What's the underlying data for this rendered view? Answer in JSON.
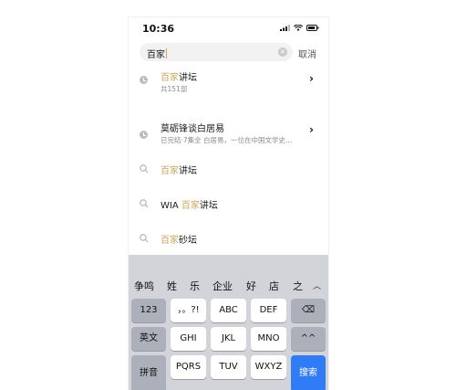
{
  "status_bar": {
    "time": "10:36"
  },
  "search": {
    "query": "百家",
    "cancel_label": "取消",
    "clear_glyph": "×"
  },
  "results": [
    {
      "type": "history",
      "title_hl": "百家",
      "title_rest": "讲坛",
      "subtitle": "共151部",
      "has_chevron": true
    },
    {
      "type": "history",
      "title_hl": "",
      "title_rest": "莫砺锋谈白居易",
      "subtitle": "已完结·7集全 白居易，一位在中国文学史…",
      "has_chevron": true
    },
    {
      "type": "suggest",
      "title_pre": "",
      "title_hl": "百家",
      "title_rest": "讲坛"
    },
    {
      "type": "suggest",
      "title_pre": "WIA ",
      "title_hl": "百家",
      "title_rest": "讲坛"
    },
    {
      "type": "suggest",
      "title_pre": "",
      "title_hl": "百家",
      "title_rest": "砂坛"
    }
  ],
  "keyboard": {
    "candidates": [
      "争鸣",
      "姓",
      "乐",
      "企业",
      "好",
      "店",
      "之"
    ],
    "candidate_expand_glyph": "︿",
    "rows": [
      [
        "123",
        "，。?!",
        "ABC",
        "DEF",
        "⌫"
      ],
      [
        "英文",
        "GHI",
        "JKL",
        "MNO",
        "^^"
      ],
      [
        "拼音",
        "PQRS",
        "TUV",
        "WXYZ",
        "搜索"
      ]
    ]
  },
  "colors": {
    "highlight": "#c8a45c",
    "key_dark": "#abb0ba",
    "search_key": "#2f7cf6"
  },
  "chevron_glyph": "›"
}
